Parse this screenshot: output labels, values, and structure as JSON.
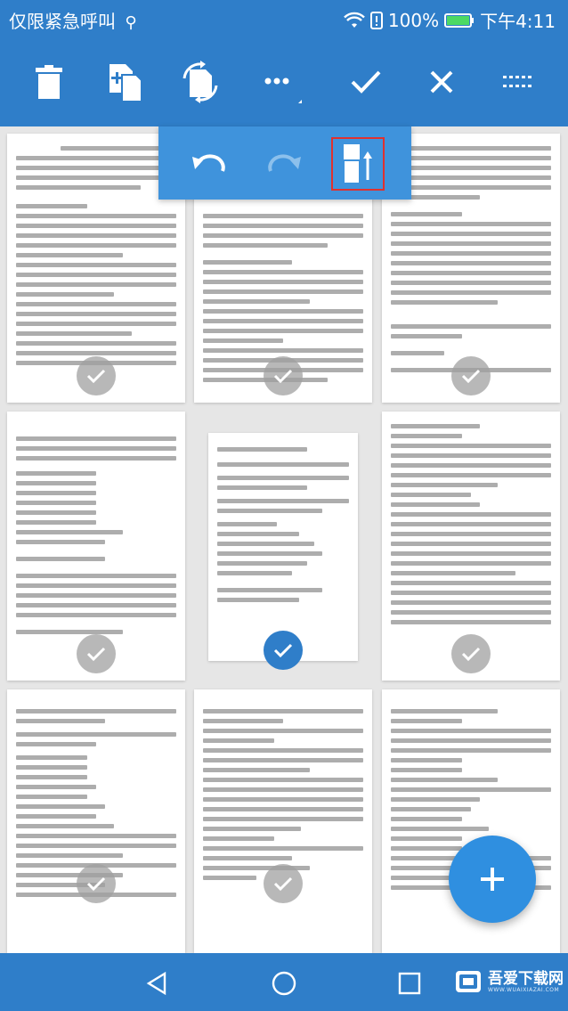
{
  "status_bar": {
    "carrier": "仅限紧急呼叫",
    "battery": "100%",
    "time": "下午4:11"
  },
  "toolbar": {
    "icons": [
      "trash-icon",
      "copy-pages-icon",
      "rotate-icon",
      "more-icon",
      "check-icon",
      "close-icon",
      "grid-icon"
    ]
  },
  "popup": {
    "icons": [
      "undo-icon",
      "redo-icon",
      "reverse-order-icon"
    ]
  },
  "pages": [
    {
      "row": 1,
      "col": 1,
      "selected": false
    },
    {
      "row": 1,
      "col": 2,
      "selected": false
    },
    {
      "row": 1,
      "col": 3,
      "selected": false
    },
    {
      "row": 2,
      "col": 1,
      "selected": false
    },
    {
      "row": 2,
      "col": 2,
      "selected": true
    },
    {
      "row": 2,
      "col": 3,
      "selected": false
    },
    {
      "row": 3,
      "col": 1,
      "selected": false
    },
    {
      "row": 3,
      "col": 2,
      "selected": false
    },
    {
      "row": 3,
      "col": 3,
      "selected": false
    }
  ],
  "fab": {
    "icon": "plus-icon"
  },
  "navbar": {
    "icons": [
      "back-icon",
      "home-icon",
      "recents-icon"
    ]
  },
  "watermark": {
    "title": "吾爱下载网",
    "subtitle": "WWW.WUAIXIAZAI.COM"
  },
  "colors": {
    "primary": "#2f7ec9",
    "popup": "#3f93dc",
    "fab": "#2f8fe0",
    "highlight": "#e0312f"
  }
}
